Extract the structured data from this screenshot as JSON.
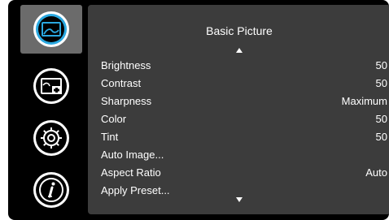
{
  "panel": {
    "title": "Basic Picture",
    "items": [
      {
        "label": "Brightness",
        "value": "50"
      },
      {
        "label": "Contrast",
        "value": "50"
      },
      {
        "label": "Sharpness",
        "value": "Maximum"
      },
      {
        "label": "Color",
        "value": "50"
      },
      {
        "label": "Tint",
        "value": "50"
      },
      {
        "label": "Auto Image...",
        "value": ""
      },
      {
        "label": "Aspect Ratio",
        "value": "Auto"
      },
      {
        "label": "Apply Preset...",
        "value": ""
      }
    ]
  },
  "sidebar": {
    "icons": [
      {
        "name": "picture-icon",
        "selected": true
      },
      {
        "name": "picture-in-picture-icon",
        "selected": false
      },
      {
        "name": "settings-gear-icon",
        "selected": false
      },
      {
        "name": "info-icon",
        "selected": false
      }
    ]
  },
  "colors": {
    "background": "#000000",
    "panel": "#3c3c3c",
    "selected_tab": "#6b6b6b",
    "accent_ring": "#2aa8e0",
    "text": "#ffffff"
  }
}
